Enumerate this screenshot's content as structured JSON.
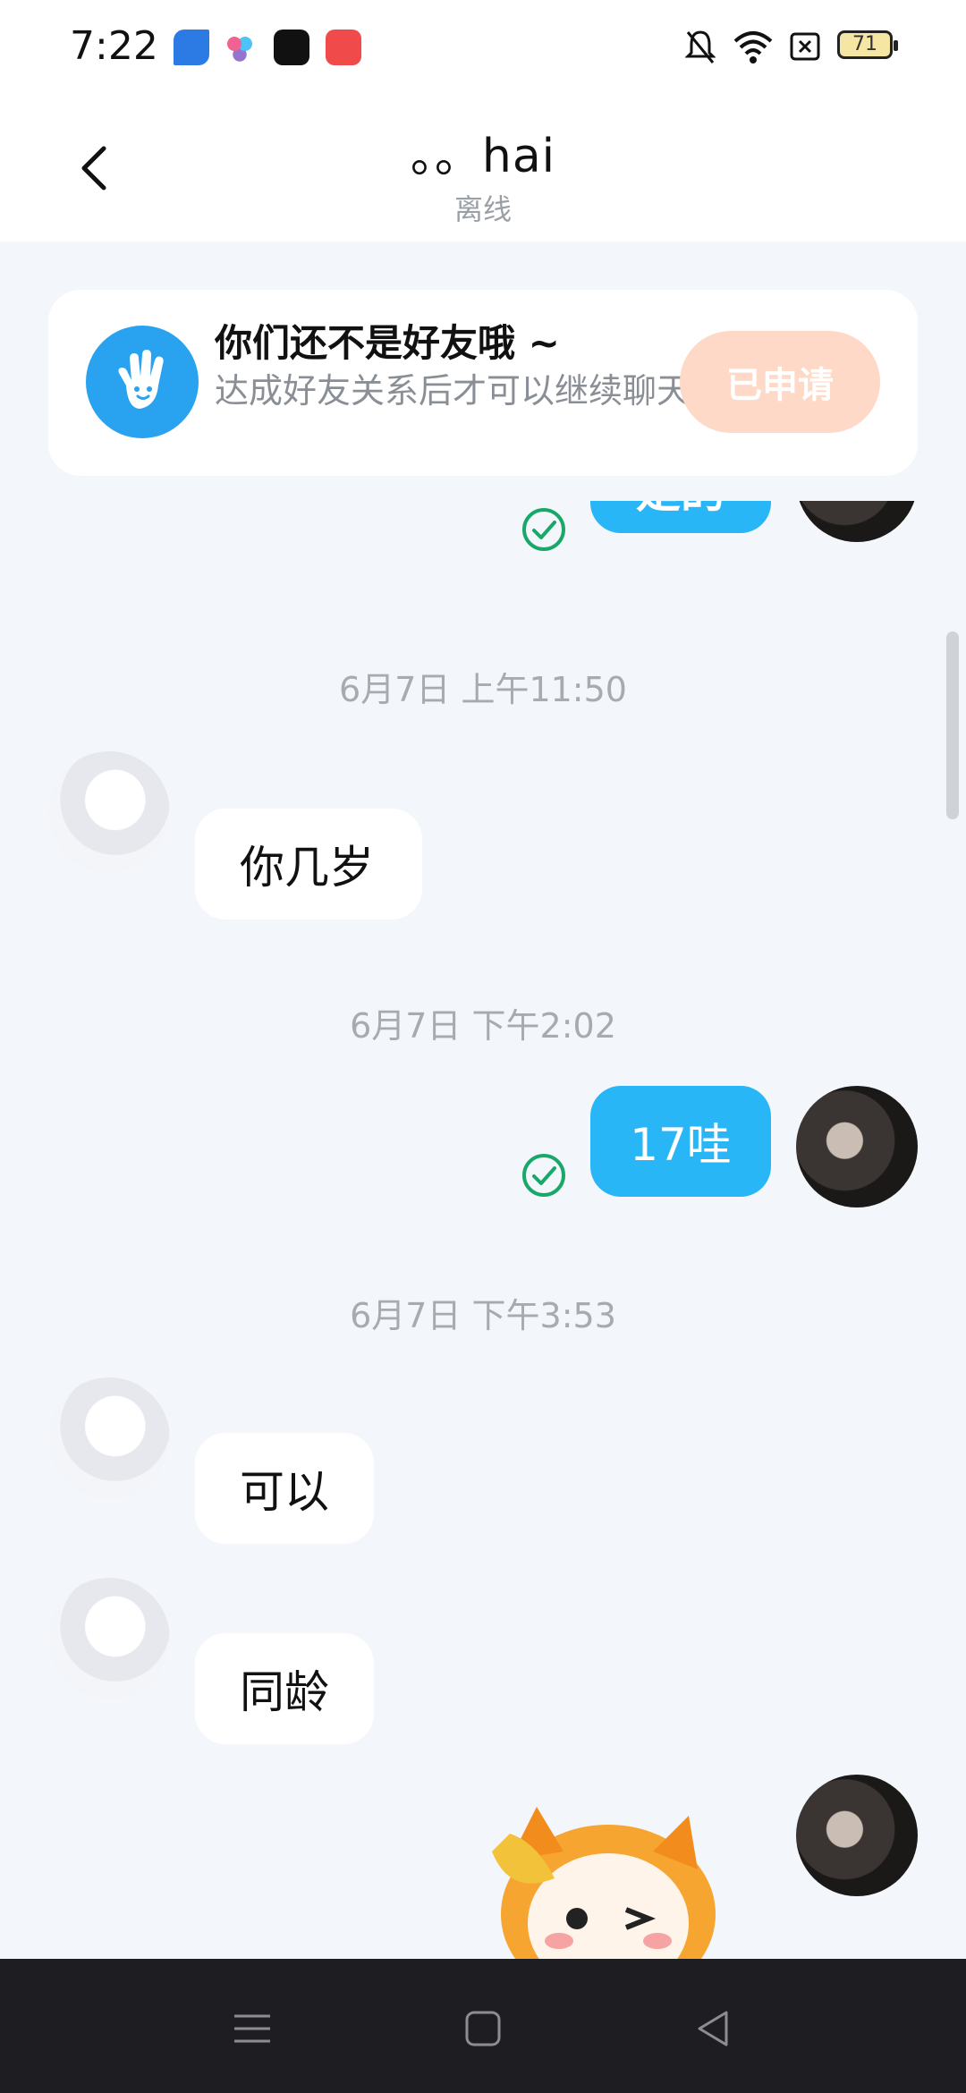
{
  "status_bar": {
    "time": "7:22",
    "battery": "71",
    "app_icons": [
      "blue-leaf-app-icon",
      "colorful-app-icon",
      "dewu-app-icon",
      "music-app-icon"
    ],
    "icons": [
      "mute-icon",
      "wifi-icon",
      "close-box-icon",
      "battery-icon"
    ]
  },
  "header": {
    "title": "。。hai",
    "subtitle": "离线"
  },
  "banner": {
    "title": "你们还不是好友哦 ~",
    "description": "达成好友关系后才可以继续聊天",
    "button_label": "已申请"
  },
  "chat": {
    "top_partial_message": "是的",
    "messages": [
      {
        "type": "timestamp",
        "text": "6月7日 上午11:50"
      },
      {
        "type": "incoming",
        "text": "你几岁"
      },
      {
        "type": "timestamp",
        "text": "6月7日 下午2:02"
      },
      {
        "type": "outgoing",
        "text": "17哇",
        "status": "read"
      },
      {
        "type": "timestamp",
        "text": "6月7日 下午3:53"
      },
      {
        "type": "incoming",
        "text": "可以"
      },
      {
        "type": "incoming",
        "text": "同龄"
      },
      {
        "type": "outgoing_sticker",
        "sticker": "cartoon-character-sticker"
      }
    ]
  },
  "colors": {
    "accent_blue": "#29b6f6",
    "apply_button_bg": "#ffd9c8",
    "read_check_green": "#1aa86a",
    "chat_bg": "#f3f6fa"
  },
  "nav_bar": {
    "buttons": [
      "menu-icon",
      "home-icon",
      "back-triangle-icon"
    ]
  }
}
